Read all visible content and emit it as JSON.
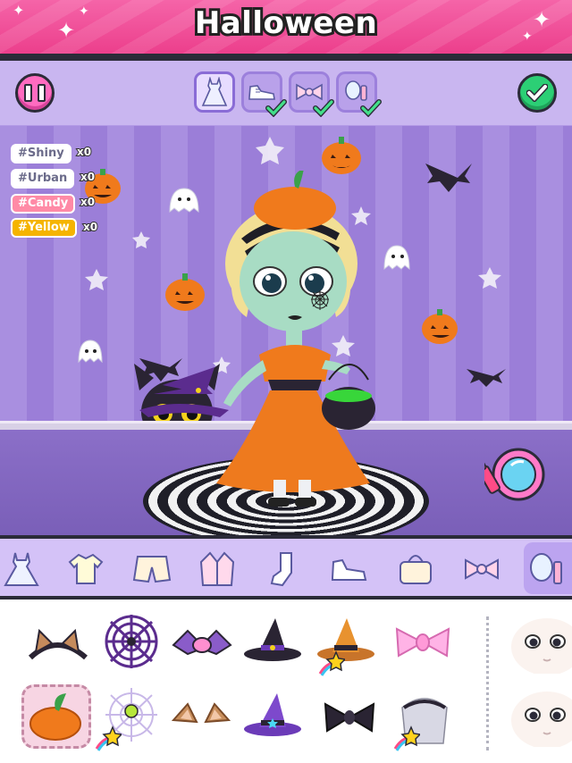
{
  "header": {
    "title": "Halloween",
    "color": "#ec3f8c"
  },
  "toolbar": {
    "pause_icon": "pause-icon",
    "confirm_icon": "check-icon",
    "tabs": [
      {
        "icon": "dress-icon",
        "checked": false,
        "active": true
      },
      {
        "icon": "sneaker-icon",
        "checked": true
      },
      {
        "icon": "bow-icon",
        "checked": true
      },
      {
        "icon": "makeup-icon",
        "checked": true
      }
    ]
  },
  "style_tags": [
    {
      "label": "#Shiny",
      "count": "x0",
      "color": "#ffffff"
    },
    {
      "label": "#Urban",
      "count": "x0",
      "color": "#ffffff"
    },
    {
      "label": "#Candy",
      "count": "x0",
      "color": "#ff8aa6"
    },
    {
      "label": "#Yellow",
      "count": "x0",
      "color": "#f5b400"
    }
  ],
  "categories": [
    {
      "icon": "dress-icon"
    },
    {
      "icon": "shirt-icon"
    },
    {
      "icon": "shorts-icon"
    },
    {
      "icon": "jacket-icon"
    },
    {
      "icon": "sock-icon"
    },
    {
      "icon": "sneaker-icon"
    },
    {
      "icon": "handbag-icon"
    },
    {
      "icon": "bow-icon"
    },
    {
      "icon": "makeup-icon",
      "selected": true
    }
  ],
  "items": [
    {
      "icon": "cat-ears-headband-icon"
    },
    {
      "icon": "spiderweb-icon"
    },
    {
      "icon": "bat-wings-headband-icon"
    },
    {
      "icon": "witch-hat-icon"
    },
    {
      "icon": "witch-hat-orange-icon",
      "rainbow_star": true
    },
    {
      "icon": "pink-bow-icon"
    },
    {
      "icon": "pumpkin-hat-icon",
      "selected": true
    },
    {
      "icon": "spider-web-hat-icon",
      "rainbow_star": true
    },
    {
      "icon": "fox-ears-icon"
    },
    {
      "icon": "purple-witch-hat-icon"
    },
    {
      "icon": "black-bow-icon"
    },
    {
      "icon": "veil-icon",
      "rainbow_star": true
    }
  ],
  "face_options": [
    {
      "icon": "face-eyes-icon"
    },
    {
      "icon": "face-eyes-icon"
    }
  ]
}
